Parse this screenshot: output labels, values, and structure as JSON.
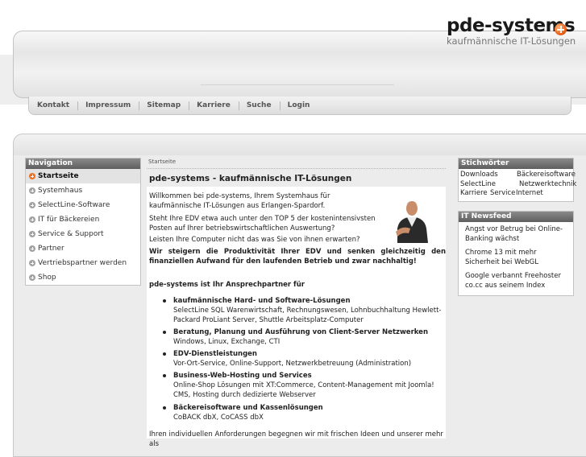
{
  "header": {
    "logo_name": "pde-systems",
    "logo_tagline": "kaufmännische IT-Lösungen"
  },
  "topnav": [
    "Kontakt",
    "Impressum",
    "Sitemap",
    "Karriere",
    "Suche",
    "Login"
  ],
  "navigation": {
    "title": "Navigation",
    "items": [
      {
        "label": "Startseite",
        "active": true
      },
      {
        "label": "Systemhaus",
        "active": false
      },
      {
        "label": "SelectLine-Software",
        "active": false
      },
      {
        "label": "IT für Bäckereien",
        "active": false
      },
      {
        "label": "Service & Support",
        "active": false
      },
      {
        "label": "Partner",
        "active": false
      },
      {
        "label": "Vertriebspartner werden",
        "active": false
      },
      {
        "label": "Shop",
        "active": false
      }
    ]
  },
  "breadcrumb": "Startseite",
  "content": {
    "title": "pde-systems - kaufmännische IT-Lösungen",
    "intro": "Willkommen bei pde-systems, Ihrem Systemhaus für kaufmännische IT-Lösungen aus Erlangen-Spardorf.",
    "p2": "Steht Ihre EDV etwa auch unter den TOP 5 der kostenintensivsten Posten auf Ihrer betriebswirtschaftlichen Auswertung?",
    "p3": "Leisten Ihre Computer nicht das was Sie von ihnen erwarten?",
    "p4": "Wir steigern die Produktivität Ihrer EDV und senken gleichzeitig den finanziellen Aufwand für den laufenden Betrieb und zwar nachhaltig!",
    "p5": "pde-systems ist Ihr Ansprechpartner für",
    "services": [
      {
        "title": "kaufmännische Hard- und Software-Lösungen",
        "desc": "SelectLine SQL Warenwirtschaft, Rechnungswesen, Lohnbuchhaltung Hewlett-Packard ProLiant Server, Shuttle Arbeitsplatz-Computer"
      },
      {
        "title": "Beratung, Planung und Ausführung von Client-Server Netzwerken",
        "desc": "Windows, Linux, Exchange, CTI"
      },
      {
        "title": "EDV-Dienstleistungen",
        "desc": "Vor-Ort-Service, Online-Support, Netzwerkbetreuung (Administration)"
      },
      {
        "title": "Business-Web-Hosting und Services",
        "desc": "Online-Shop Lösungen mit XT:Commerce, Content-Management mit Joomla! CMS, Hosting durch dedizierte Webserver"
      },
      {
        "title": "Bäckereisoftware und Kassenlösungen",
        "desc": "CoBACK dbX, CoCASS dbX"
      }
    ],
    "p_last": "Ihren individuellen Anforderungen begegnen wir mit frischen Ideen und unserer mehr als"
  },
  "keywords": {
    "title": "Stichwörter",
    "items": [
      "Downloads",
      "Bäckereisoftware",
      "SelectLine",
      "Netzwerktechnik",
      "Karriere",
      "Service",
      "Internet"
    ]
  },
  "news": {
    "title": "IT Newsfeed",
    "items": [
      "Angst vor Betrug bei Online-Banking wächst",
      "Chrome 13 mit mehr Sicherheit bei WebGL",
      "Google verbannt Freehoster co.cc aus seinem Index"
    ]
  },
  "colors": {
    "accent": "#f07020",
    "box_title": "#6e6e6e",
    "background": "#ececec"
  }
}
